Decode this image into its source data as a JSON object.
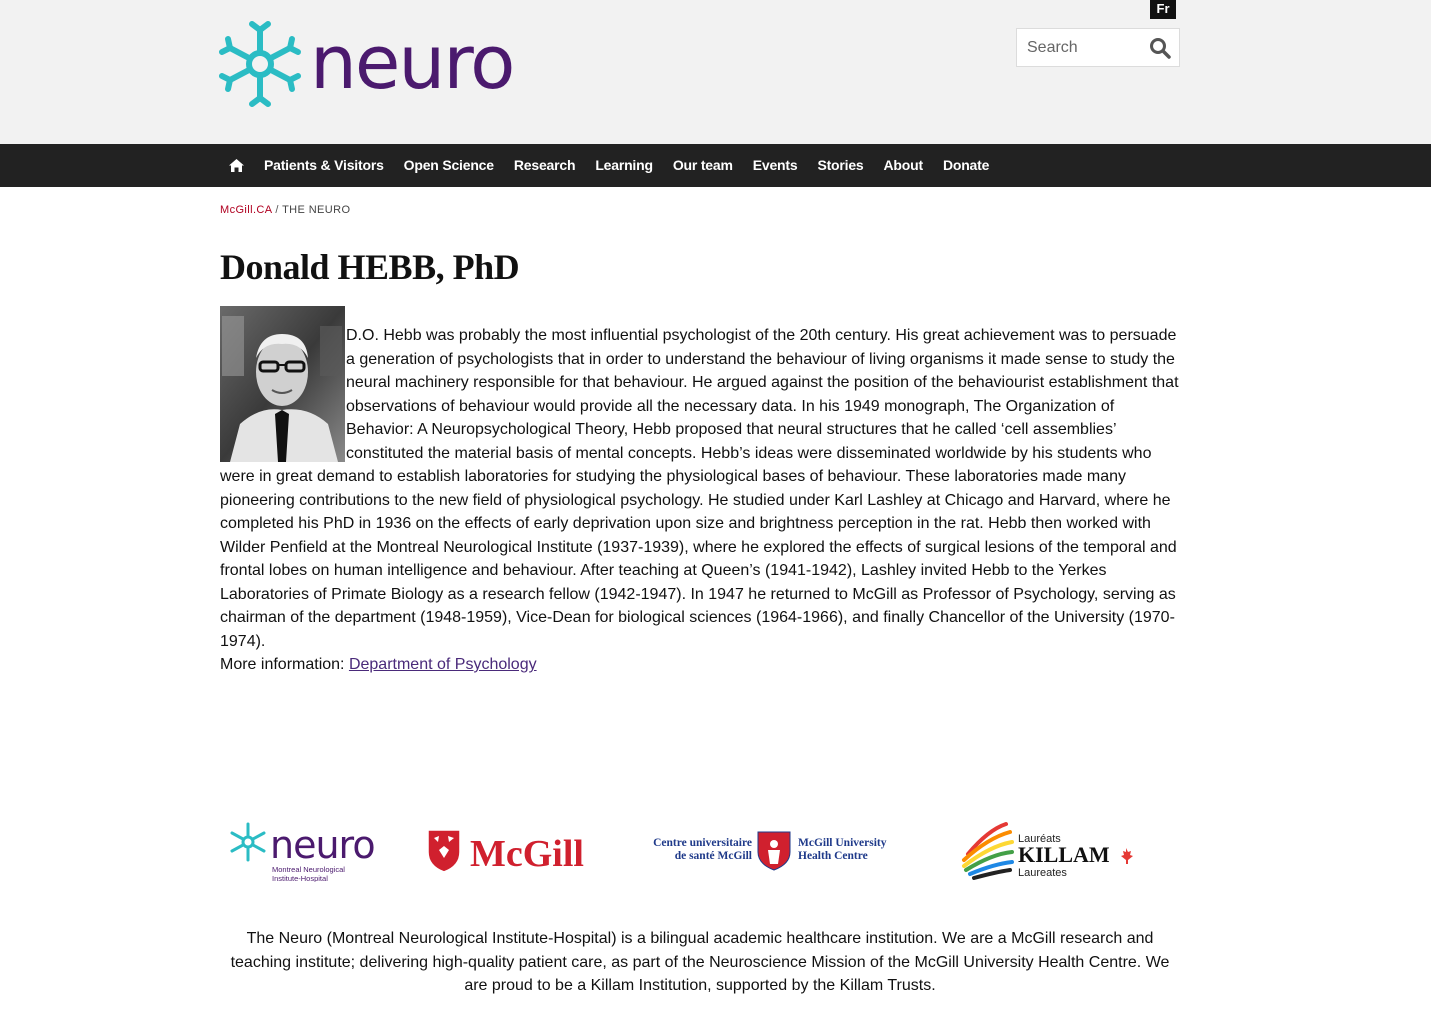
{
  "header": {
    "logo_text": "neuro",
    "lang_toggle": "Fr",
    "search": {
      "placeholder": "Search",
      "value": ""
    }
  },
  "nav": {
    "home_icon": "home-icon",
    "items": [
      {
        "label": "Patients & Visitors"
      },
      {
        "label": "Open Science"
      },
      {
        "label": "Research"
      },
      {
        "label": "Learning"
      },
      {
        "label": "Our team"
      },
      {
        "label": "Events"
      },
      {
        "label": "Stories"
      },
      {
        "label": "About"
      },
      {
        "label": "Donate"
      }
    ]
  },
  "breadcrumb": {
    "root": "McGill.CA",
    "separator": " / ",
    "current": "THE NEURO"
  },
  "page": {
    "title": "Donald HEBB, PhD",
    "bio": "D.O. Hebb was probably the most influential psychologist of the 20th century. His great achievement was to persuade a generation of psychologists that in order to understand the behaviour of living organisms it made sense to study the neural machinery responsible for that behaviour. He argued against the position of the behaviourist establishment that observations of behaviour would provide all the necessary data. In his 1949 monograph, The Organization of Behavior: A Neuropsychological Theory, Hebb proposed that neural structures that he called ‘cell assemblies’ constituted the material basis of mental concepts. Hebb’s ideas were disseminated worldwide by his students who were in great demand to establish laboratories for studying the physiological bases of behaviour. These laboratories made many pioneering contributions to the new field of physiological psychology.  He studied under Karl Lashley at Chicago and Harvard, where he completed his PhD in 1936 on the effects of early deprivation upon size and brightness perception in the rat. Hebb then worked with Wilder Penfield at the Montreal Neurological Institute (1937-1939), where he explored the effects of surgical lesions of the temporal and frontal lobes on human intelligence and behaviour. After teaching at Queen’s (1941-1942), Lashley invited Hebb to the Yerkes Laboratories of Primate Biology as a research fellow (1942-1947). In 1947 he returned to McGill as Professor of Psychology, serving as chairman of the department (1948-1959), Vice-Dean for biological sciences (1964-1966), and finally Chancellor of the University (1970-1974).",
    "more_info_label": "More information: ",
    "more_info_link": "Department of Psychology"
  },
  "partners": {
    "neuro": {
      "name": "neuro",
      "sub1": "Montreal Neurological",
      "sub2": "Institute-Hospital"
    },
    "mcgill": {
      "name": "McGill"
    },
    "muhc": {
      "fr1": "Centre universitaire",
      "fr2": "de santé McGill",
      "en1": "McGill University",
      "en2": "Health Centre"
    },
    "killam": {
      "top": "Lauréats",
      "name": "KILLAM",
      "bottom": "Laureates"
    }
  },
  "footer": {
    "text": "The Neuro (Montreal Neurological Institute-Hospital) is a bilingual academic healthcare institution. We are a McGill research and teaching institute; delivering high-quality patient care, as part of the Neuroscience Mission of the McGill University Health Centre. We are proud to be a Killam Institution, supported by the Killam Trusts."
  },
  "colors": {
    "brand_purple": "#4b1a6e",
    "brand_teal": "#2bbcc4",
    "nav_bg": "#222222",
    "mcgill_red": "#d0202e",
    "header_bg": "#f2f2f2"
  }
}
